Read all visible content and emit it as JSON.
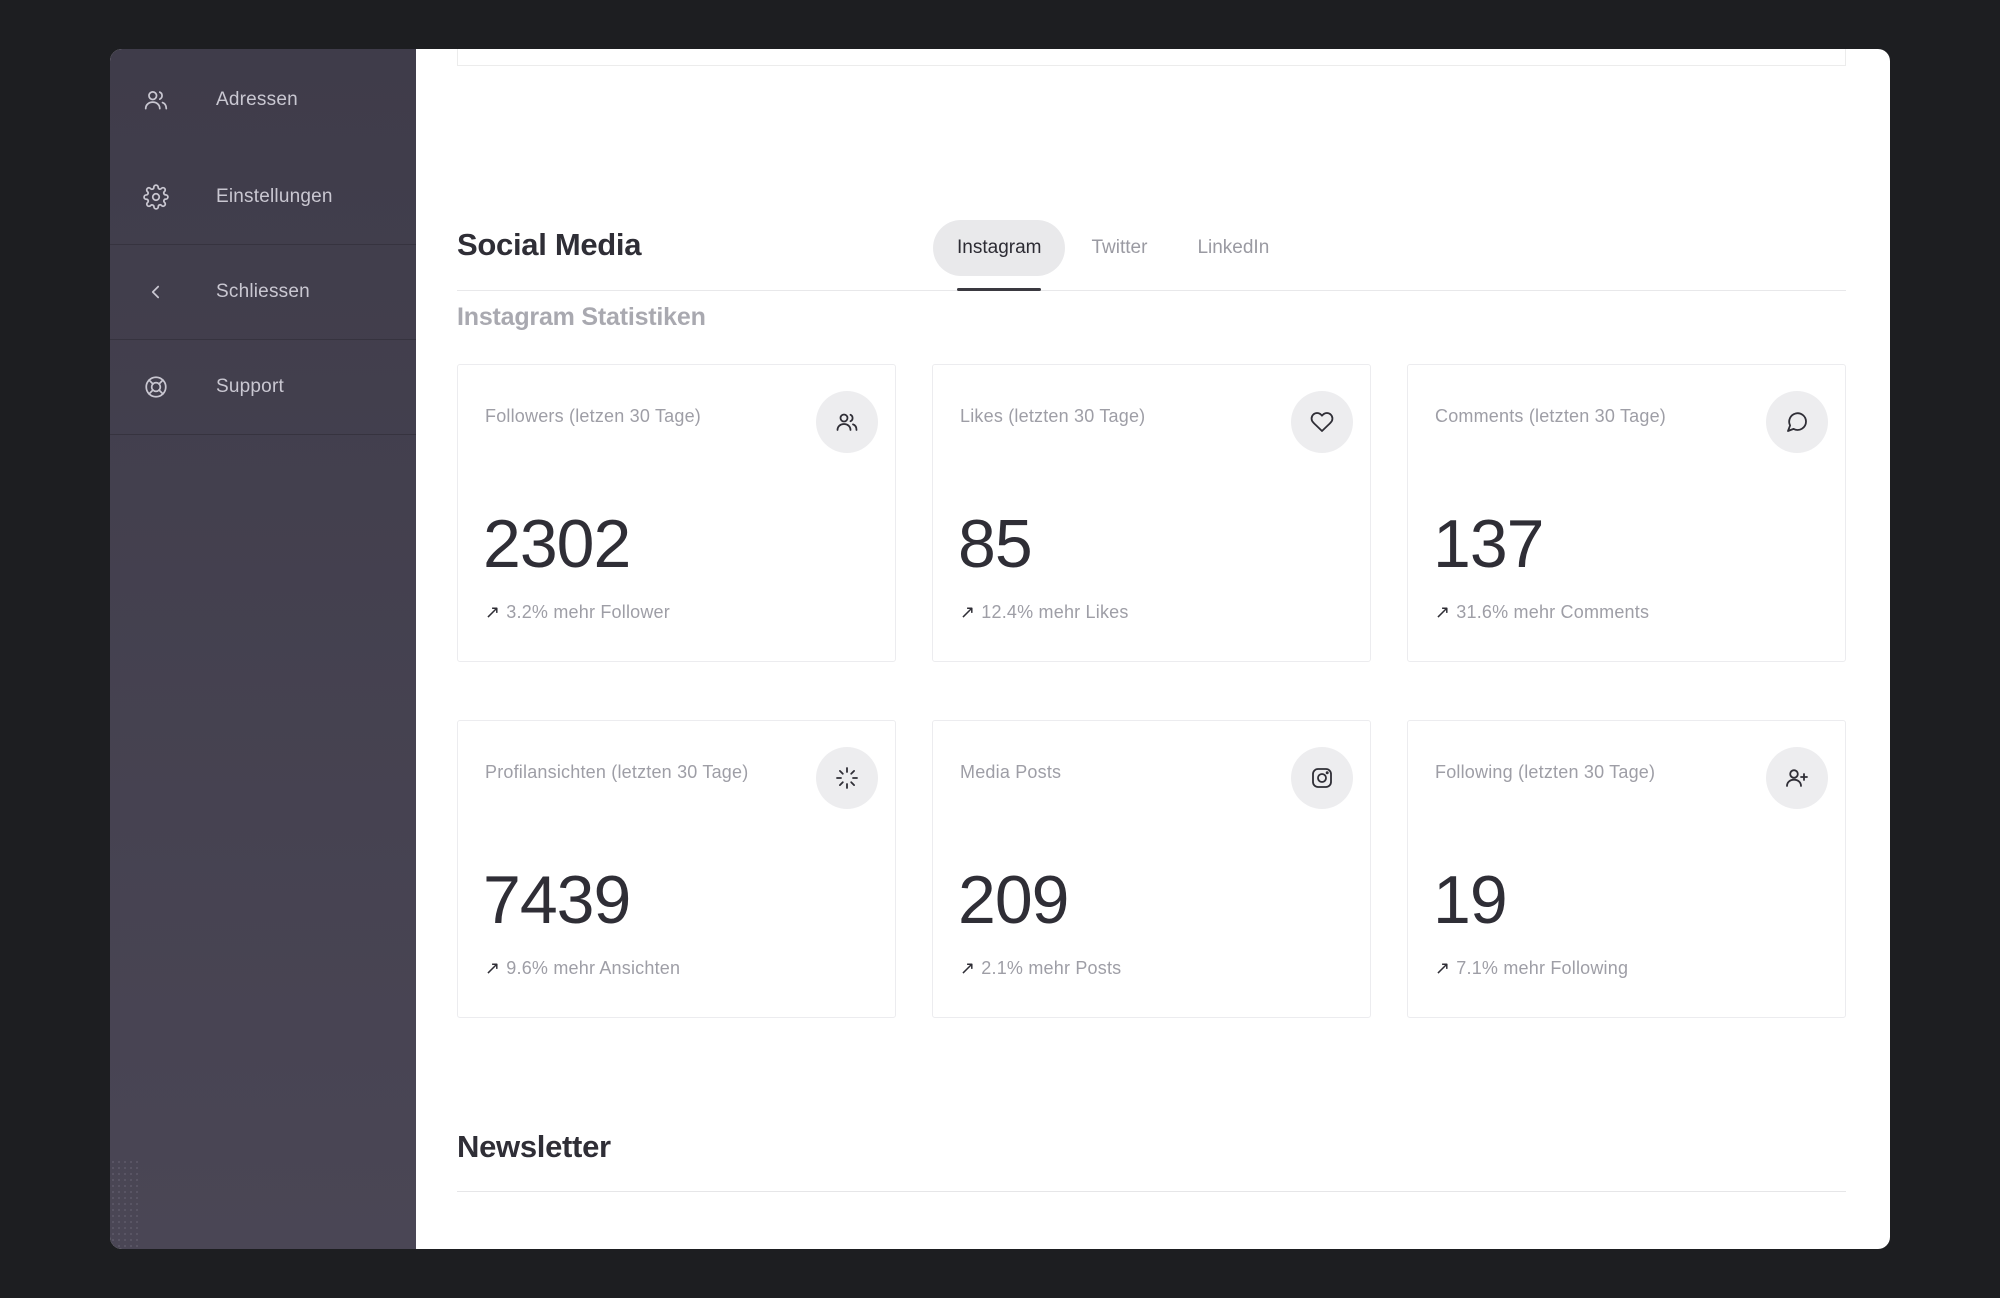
{
  "sidebar": {
    "items": [
      {
        "label": "Adressen",
        "icon": "users-icon"
      },
      {
        "label": "Einstellungen",
        "icon": "gear-icon"
      },
      {
        "label": "Schliessen",
        "icon": "chevron-left-icon"
      },
      {
        "label": "Support",
        "icon": "lifebuoy-icon"
      }
    ]
  },
  "social": {
    "title": "Social Media",
    "tabs": [
      {
        "label": "Instagram",
        "active": true
      },
      {
        "label": "Twitter",
        "active": false
      },
      {
        "label": "LinkedIn",
        "active": false
      }
    ],
    "subtitle": "Instagram Statistiken"
  },
  "cards": [
    {
      "label": "Followers (letzen 30 Tage)",
      "value": "2302",
      "delta": "3.2% mehr Follower",
      "icon": "users-icon"
    },
    {
      "label": "Likes (letzten 30 Tage)",
      "value": "85",
      "delta": "12.4% mehr Likes",
      "icon": "heart-icon"
    },
    {
      "label": "Comments (letzten 30 Tage)",
      "value": "137",
      "delta": "31.6% mehr Comments",
      "icon": "comment-icon"
    },
    {
      "label": "Profilansichten (letzten 30 Tage)",
      "value": "7439",
      "delta": "9.6% mehr Ansichten",
      "icon": "loader-icon"
    },
    {
      "label": "Media Posts",
      "value": "209",
      "delta": "2.1% mehr Posts",
      "icon": "instagram-icon"
    },
    {
      "label": "Following (letzten 30 Tage)",
      "value": "19",
      "delta": "7.1% mehr Following",
      "icon": "user-plus-icon"
    }
  ],
  "newsletter": {
    "title": "Newsletter"
  },
  "colors": {
    "sidebar_bg": "#403d4b",
    "text_dark": "#2f2e36",
    "text_muted": "#9e9ea6",
    "page_bg": "#1d1e21"
  }
}
